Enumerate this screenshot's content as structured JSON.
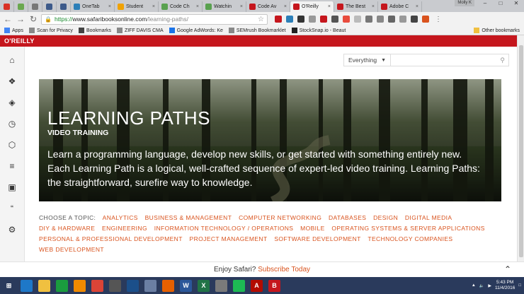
{
  "browser": {
    "tabs": [
      {
        "label": "",
        "icon": "gmail-icon",
        "color": "#d93025",
        "pinned": true
      },
      {
        "label": "",
        "icon": "slack-icon",
        "color": "#6aa84f",
        "pinned": true
      },
      {
        "label": "",
        "icon": "pinned-app-icon",
        "color": "#777777",
        "pinned": true
      },
      {
        "label": "",
        "icon": "pinned-app-icon",
        "color": "#3d5a8a",
        "pinned": true
      },
      {
        "label": "",
        "icon": "pinned-app-icon",
        "color": "#3d5a8a",
        "pinned": true
      },
      {
        "label": "OneTab",
        "icon": "onetab-icon",
        "color": "#2c7fb8"
      },
      {
        "label": "Student",
        "icon": "student-icon",
        "color": "#f0a202"
      },
      {
        "label": "Code Ch",
        "icon": "code-icon",
        "color": "#59a14f"
      },
      {
        "label": "Watchin",
        "icon": "watching-icon",
        "color": "#59a14f"
      },
      {
        "label": "Code Av",
        "icon": "code-av-icon",
        "color": "#c5161d"
      },
      {
        "label": "O'Reilly",
        "icon": "oreilly-icon",
        "color": "#c5161d",
        "active": true
      },
      {
        "label": "The Best",
        "icon": "pc-icon",
        "color": "#c5161d"
      },
      {
        "label": "Adobe C",
        "icon": "pc-icon",
        "color": "#c5161d"
      }
    ],
    "profile": "Molly K",
    "url_https": "https://",
    "url_host": "www.safaribooksonline.com",
    "url_path": "/learning-paths/",
    "bookmarks": [
      {
        "label": "Apps",
        "icon": "apps-icon"
      },
      {
        "label": "Scan for Privacy",
        "icon": "page-icon"
      },
      {
        "label": "Bookmarks",
        "icon": "star-icon"
      },
      {
        "label": "ZIFF DAVIS CMA",
        "icon": "page-icon"
      },
      {
        "label": "Google AdWords: Ke",
        "icon": "adwords-icon"
      },
      {
        "label": "SEMrush Bookmarklet",
        "icon": "page-icon"
      },
      {
        "label": "StockSnap.io - Beaut",
        "icon": "stocksnap-icon"
      }
    ],
    "other_bookmarks": "Other bookmarks"
  },
  "site": {
    "logo": "O'REILLY",
    "search_select": "Everything",
    "search_placeholder": "",
    "hero": {
      "title": "LEARNING PATHS",
      "subtitle": "VIDEO TRAINING",
      "description": "Learn a programming language, develop new skills, or get started with something entirely new. Each Learning Path is a logical, well-crafted sequence of expert-led video training. Learning Paths: the straightforward, surefire way to knowledge."
    },
    "topics_label": "CHOOSE A TOPIC:",
    "topics": [
      "ANALYTICS",
      "BUSINESS & MANAGEMENT",
      "COMPUTER NETWORKING",
      "DATABASES",
      "DESIGN",
      "DIGITAL MEDIA",
      "DIY & HARDWARE",
      "ENGINEERING",
      "INFORMATION TECHNOLOGY / OPERATIONS",
      "MOBILE",
      "OPERATING SYSTEMS & SERVER APPLICATIONS",
      "PERSONAL & PROFESSIONAL DEVELOPMENT",
      "PROJECT MANAGEMENT",
      "SOFTWARE DEVELOPMENT",
      "TECHNOLOGY COMPANIES",
      "WEB DEVELOPMENT"
    ],
    "enjoy_text": "Enjoy Safari?",
    "subscribe_link": "Subscribe Today",
    "sidebar_icons": [
      "home-icon",
      "topics-icon",
      "layers-icon",
      "history-icon",
      "hexagon-icon",
      "playlist-icon",
      "boxes-icon",
      "quote-icon",
      "settings-icon"
    ]
  },
  "taskbar": {
    "apps": [
      {
        "icon": "windows-start-icon",
        "color": "#2a3a5c"
      },
      {
        "icon": "ie-icon",
        "color": "#1e78c8"
      },
      {
        "icon": "file-explorer-icon",
        "color": "#f0c040"
      },
      {
        "icon": "store-icon",
        "color": "#1a9c3e"
      },
      {
        "icon": "vlc-icon",
        "color": "#f08a00"
      },
      {
        "icon": "chrome-icon",
        "color": "#db4437"
      },
      {
        "icon": "calculator-icon",
        "color": "#555555"
      },
      {
        "icon": "amazon-icon",
        "color": "#1b4f8a"
      },
      {
        "icon": "home-app-icon",
        "color": "#6b7fa3"
      },
      {
        "icon": "firefox-icon",
        "color": "#e66000"
      },
      {
        "icon": "word-icon",
        "color": "#2b579a"
      },
      {
        "icon": "excel-icon",
        "color": "#217346"
      },
      {
        "icon": "paint-icon",
        "color": "#7a7a7a"
      },
      {
        "icon": "spotify-icon",
        "color": "#1db954"
      },
      {
        "icon": "acrobat-icon",
        "color": "#b30b00"
      },
      {
        "icon": "b-app-icon",
        "color": "#c5161d"
      }
    ],
    "time": "5:43 PM",
    "date": "11/4/2016"
  }
}
